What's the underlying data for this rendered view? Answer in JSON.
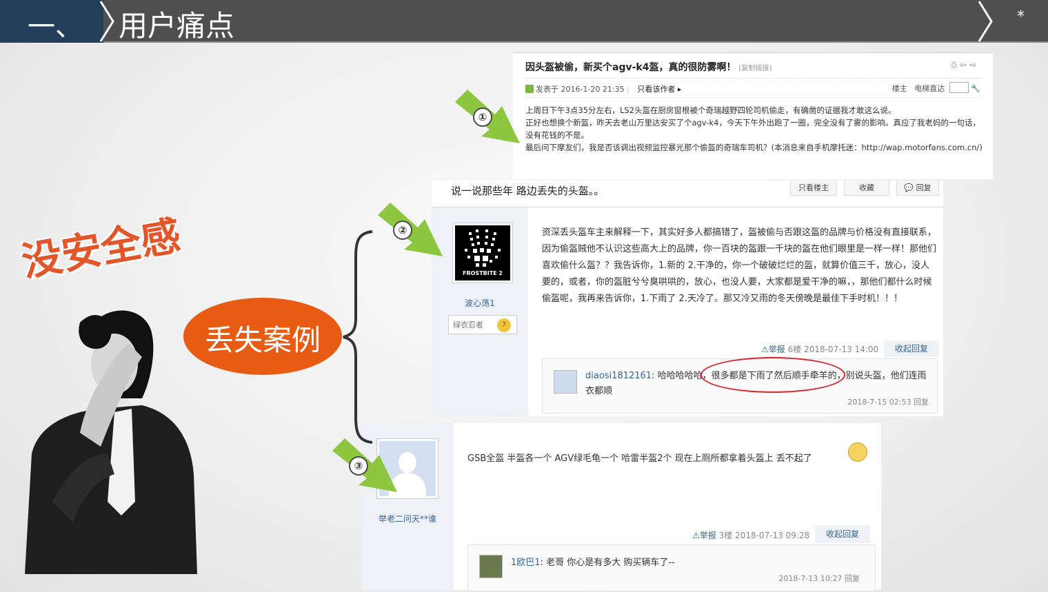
{
  "header": {
    "number": "一、",
    "title": "用户痛点",
    "star": "*"
  },
  "left": {
    "headline": "没安全感",
    "tag": "丢失案例"
  },
  "post1": {
    "title": "因头盔被偷，新买个agv-k4盔，真的很防雾啊！",
    "copy_link": "[复制链接]",
    "posted": "发表于 2016-1-20 21:35",
    "only_author": "只看该作者",
    "floor_owner": "楼主",
    "elevator": "电梯直达",
    "lines": [
      "上周日下午3点35分左右，LS2头盔在厨房窗根被个奇瑞越野四轮司机偷走，有确凿的证据我才敢这么说。",
      "正好也想换个新盔，昨天去老山万里达安买了个agv-k4，今天下午外出跑了一圈，完全没有了雾的影响。真应了我老妈的一句话，没有花钱的不是。",
      "最后问下摩友们，我是否该调出视频监控暴光那个偷盔的奇瑞车司机？(本消息来自手机摩托迷：http://wap.motorfans.com.cn/)"
    ]
  },
  "post2": {
    "thread_title": "说一说那些年 路边丢失的头盔。。",
    "btn_only_owner": "只看楼主",
    "btn_collect": "收藏",
    "btn_reply": "回复",
    "avatar_text": "FROSTBITE 2",
    "username": "波心荡1",
    "rank": "绿衣忍者",
    "rank_level": "7",
    "content": "资深丢头盔车主来解释一下，其实好多人都搞错了，盔被偷与否跟这盔的品牌与价格没有直接联系，因为偷盔贼他不认识这些高大上的品牌，你一百块的盔跟一千块的盔在他们眼里是一样一样！那他们喜欢偷什么盔？？我告诉你，1.新的 2.干净的，你一个破破烂烂的盔，就算价值三千，放心，没人要的，或者，你的盔脏兮兮臭哄哄的，放心，也没人要，大家都是爱干净的嘛，，那他们都什么时候偷盔呢，我再来告诉你，1.下雨了 2.天冷了。那又冷又雨的冬天傍晚是最佳下手时机！！！",
    "report": "举报",
    "floor_info": "6楼 2018-07-13 14:00",
    "fold": "收起回复",
    "reply_name": "diaosi1812161",
    "reply_text": "哈哈哈哈哈，很多都是下雨了然后顺手牵羊的，别说头盔，他们连雨衣都顺",
    "reply_time": "2018-7-15 02:53 回复"
  },
  "post3": {
    "username": "举老二问天**谁",
    "content": "GSB全盔 半盔各一个 AGV绿毛龟一个 哈雷半盔2个 现在上厕所都拿着头盔上 丢不起了",
    "report": "举报",
    "floor_info": "3楼 2018-07-13 09:28",
    "fold": "收起回复",
    "reply_name": "1欧巴1",
    "reply_text": "老哥 你心是有多大 购买辆车了--",
    "reply_time": "2018-7-13 10:27 回复"
  },
  "markers": [
    "①",
    "②",
    "③"
  ],
  "colors": {
    "accent_orange": "#e85b12",
    "arrow_green": "#8dc63f",
    "header_dark": "#4f4f4f",
    "header_blue": "#233f5a",
    "highlight_red": "#d9232d"
  }
}
